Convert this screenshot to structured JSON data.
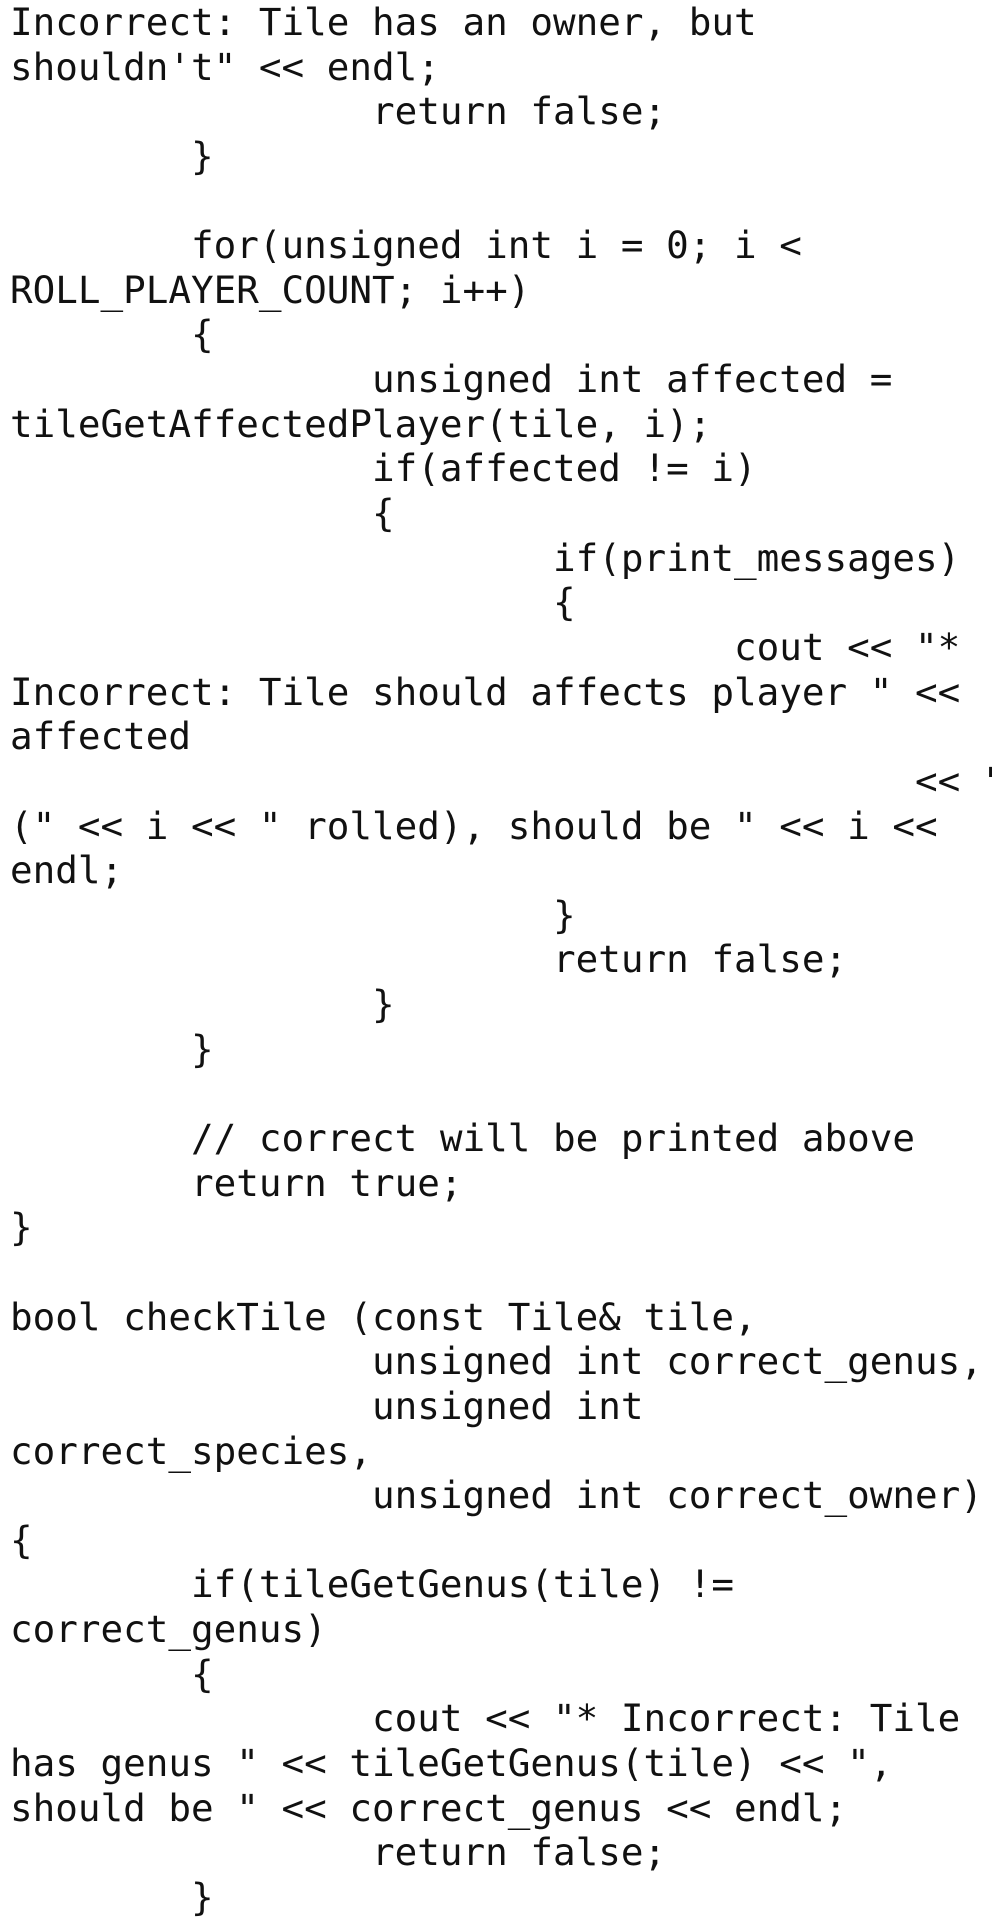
{
  "document": {
    "lines": [
      "Incorrect: Tile has an owner, but",
      "shouldn't\" << endl;",
      "                return false;",
      "        }",
      "",
      "        for(unsigned int i = 0; i <",
      "ROLL_PLAYER_COUNT; i++)",
      "        {",
      "                unsigned int affected =",
      "tileGetAffectedPlayer(tile, i);",
      "                if(affected != i)",
      "                {",
      "                        if(print_messages)",
      "                        {",
      "                                cout << \"*",
      "Incorrect: Tile should affects player \" <<",
      "affected",
      "                                        << \"",
      "(\" << i << \" rolled), should be \" << i <<",
      "endl;",
      "                        }",
      "                        return false;",
      "                }",
      "        }",
      "",
      "        // correct will be printed above",
      "        return true;",
      "}",
      "",
      "bool checkTile (const Tile& tile,",
      "                unsigned int correct_genus,",
      "                unsigned int",
      "correct_species,",
      "                unsigned int correct_owner)",
      "{",
      "        if(tileGetGenus(tile) !=",
      "correct_genus)",
      "        {",
      "                cout << \"* Incorrect: Tile",
      "has genus \" << tileGetGenus(tile) << \",",
      "should be \" << correct_genus << endl;",
      "                return false;",
      "        }"
    ]
  }
}
